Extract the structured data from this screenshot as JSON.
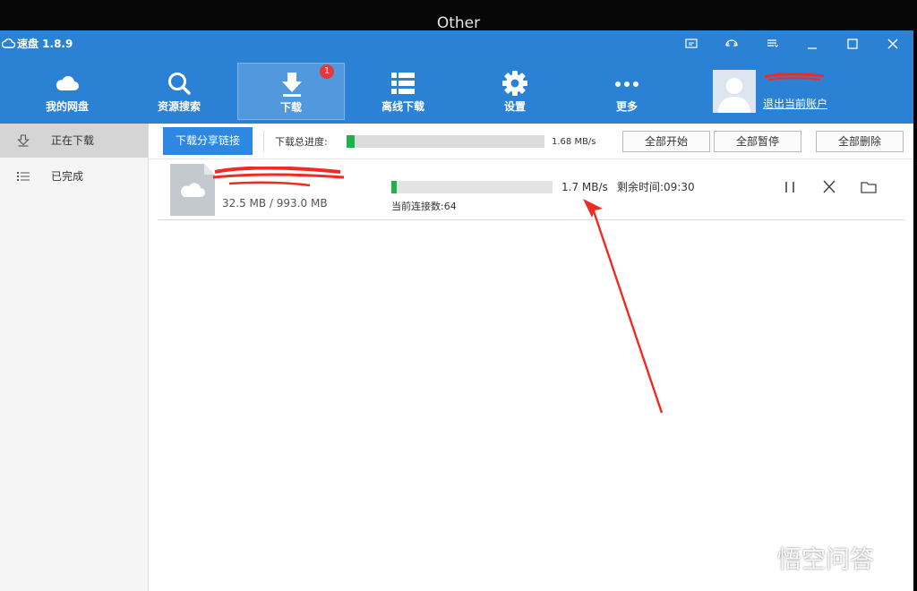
{
  "desktop": {
    "caption": "Other"
  },
  "window": {
    "title": "速盘 1.8.9",
    "controls": [
      "screen-icon",
      "transfer-icon",
      "menu-icon",
      "minimize-icon",
      "maximize-icon",
      "close-icon"
    ]
  },
  "toolbar": {
    "items": [
      {
        "label": "我的网盘",
        "icon": "cloud-icon"
      },
      {
        "label": "资源搜索",
        "icon": "search-icon"
      },
      {
        "label": "下载",
        "icon": "download-icon",
        "badge": "1",
        "active": true
      },
      {
        "label": "离线下载",
        "icon": "list-icon"
      },
      {
        "label": "设置",
        "icon": "gear-icon"
      },
      {
        "label": "更多",
        "icon": "more-icon"
      }
    ],
    "account": {
      "logout_label": "退出当前账户"
    }
  },
  "sidebar": {
    "items": [
      {
        "label": "正在下载",
        "icon": "download-arrow-icon",
        "active": true
      },
      {
        "label": "已完成",
        "icon": "list-icon"
      }
    ]
  },
  "downloads": {
    "share_button": "下载分享链接",
    "total_progress_label": "下载总进度:",
    "total_progress": 0.04,
    "total_speed": "1.68 MB/s",
    "buttons": {
      "start_all": "全部开始",
      "pause_all": "全部暂停",
      "delete_all": "全部删除"
    },
    "tasks": [
      {
        "size_text": "32.5 MB / 993.0 MB",
        "progress": 0.033,
        "speed": "1.7 MB/s",
        "time_left": "剩余时间:09:30",
        "connections": "当前连接数:64"
      }
    ]
  },
  "colors": {
    "accent": "#2b81d4",
    "progress": "#1db34a",
    "annotation": "#ee2c24",
    "badge": "#e5383b"
  },
  "watermark": {
    "text": "悟空问答"
  }
}
